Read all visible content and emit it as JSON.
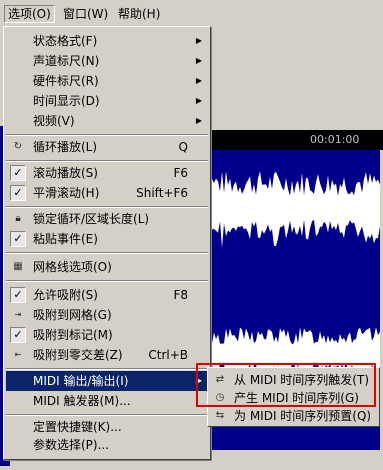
{
  "menubar": {
    "items": [
      {
        "label": "选项(O)"
      },
      {
        "label": "窗口(W)"
      },
      {
        "label": "帮助(H)"
      }
    ]
  },
  "waveform": {
    "time_label": "00:01:00"
  },
  "options_menu": {
    "items": [
      {
        "label": "状态格式(F)",
        "submenu": true
      },
      {
        "label": "声道标尺(N)",
        "submenu": true
      },
      {
        "label": "硬件标尺(R)",
        "submenu": true
      },
      {
        "label": "时间显示(D)",
        "submenu": true
      },
      {
        "label": "视频(V)",
        "submenu": true
      },
      {
        "label": "循环播放(L)",
        "shortcut": "Q",
        "icon": "loop-icon"
      },
      {
        "label": "滚动播放(S)",
        "shortcut": "F6",
        "checked": true
      },
      {
        "label": "平滑滚动(H)",
        "shortcut": "Shift+F6",
        "checked": true
      },
      {
        "label": "锁定循环/区域长度(L)",
        "icon": "lock-icon"
      },
      {
        "label": "粘贴事件(E)",
        "checked": true
      },
      {
        "label": "网格线选项(O)",
        "icon": "grid-icon"
      },
      {
        "label": "允许吸附(S)",
        "shortcut": "F8",
        "checked": true
      },
      {
        "label": "吸附到网格(G)",
        "icon": "snap-grid-icon"
      },
      {
        "label": "吸附到标记(M)",
        "checked": true
      },
      {
        "label": "吸附到零交差(Z)",
        "shortcut": "Ctrl+B",
        "icon": "snap-zero-icon"
      },
      {
        "label": "MIDI 输出/输出(I)",
        "submenu": true,
        "highlighted": true
      },
      {
        "label": "MIDI 触发器(M)..."
      },
      {
        "label": "定置快捷键(K)..."
      },
      {
        "label": "参数选择(P)..."
      }
    ]
  },
  "midi_submenu": {
    "items": [
      {
        "label": "从 MIDI 时间序列触发(T)",
        "icon": "midi-trigger-icon"
      },
      {
        "label": "产生 MIDI 时间序列(G)",
        "icon": "midi-generate-icon"
      },
      {
        "label": "为 MIDI 时间序列预置(Q)",
        "icon": "midi-preset-icon"
      }
    ]
  }
}
